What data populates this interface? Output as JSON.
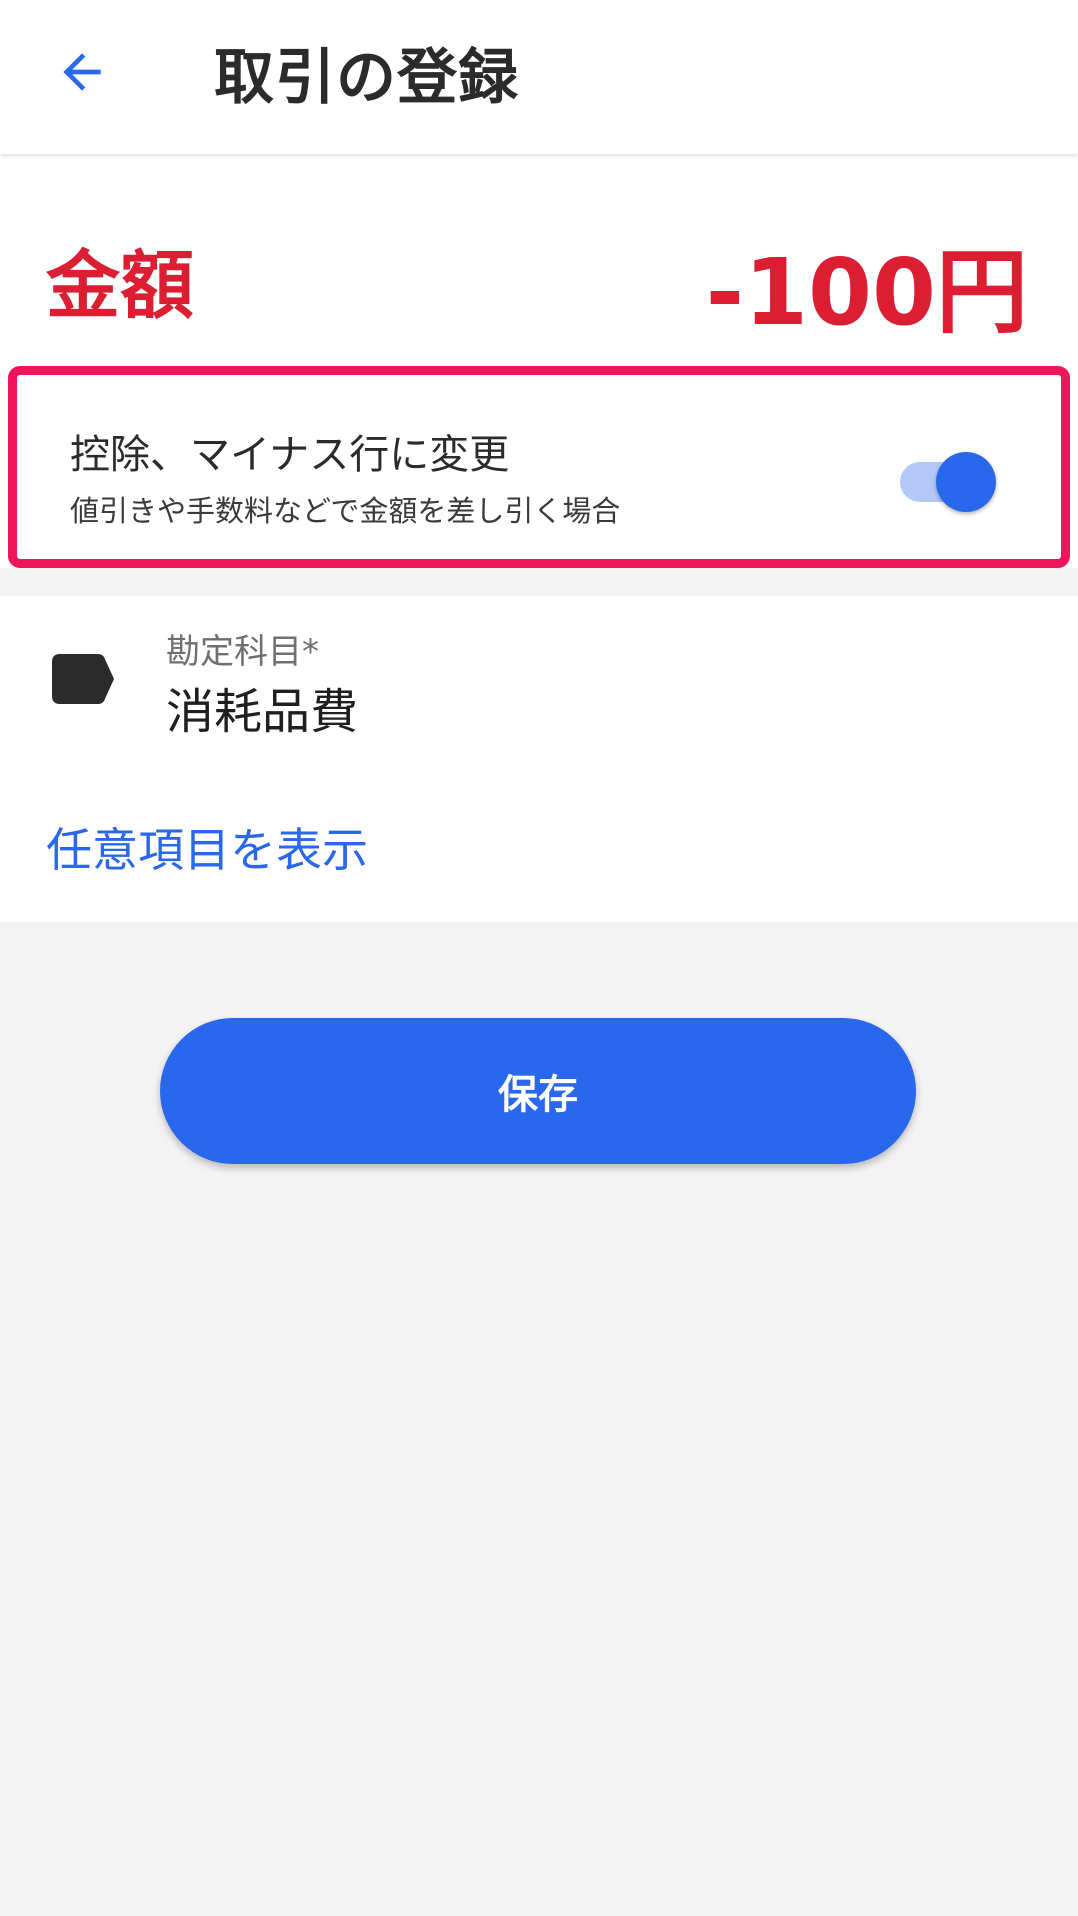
{
  "appbar": {
    "title": "取引の登録",
    "back_icon": "arrow-left-icon"
  },
  "amount": {
    "label": "金額",
    "value": "-100円"
  },
  "deduction": {
    "title": "控除、マイナス行に変更",
    "subtitle": "値引きや手数料などで金額を差し引く場合",
    "enabled": true
  },
  "account": {
    "icon": "tag-icon",
    "label": "勘定科目*",
    "value": "消耗品費"
  },
  "optional_link": "任意項目を表示",
  "save_label": "保存",
  "colors": {
    "accent": "#2967ec",
    "amount": "#dc1e32",
    "highlight": "#f0145a"
  }
}
